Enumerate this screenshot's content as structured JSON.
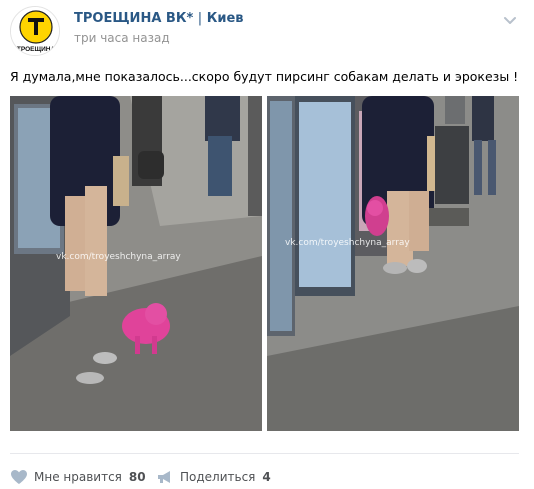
{
  "post": {
    "author": "ТРОЕЩИНА ВК*",
    "separator": "|",
    "city": "Киев",
    "time": "три часа назад",
    "text": "Я думала,мне показалось...скоро будут пирсинг собакам делать и эрокезы !",
    "avatar_text": "ТРОЕЩИНА"
  },
  "photos": [
    {
      "watermark": "vk.com/troyeshchyna_array"
    },
    {
      "watermark": "vk.com/troyeshchyna_array"
    }
  ],
  "actions": {
    "like_label": "Мне нравится",
    "like_count": "80",
    "share_label": "Поделиться",
    "share_count": "4"
  },
  "colors": {
    "link": "#2a5885",
    "muted": "#939393",
    "pink_dog": "#e0439a"
  },
  "icons": {
    "more": "chevron-down-icon",
    "like": "heart-icon",
    "share": "megaphone-icon"
  }
}
